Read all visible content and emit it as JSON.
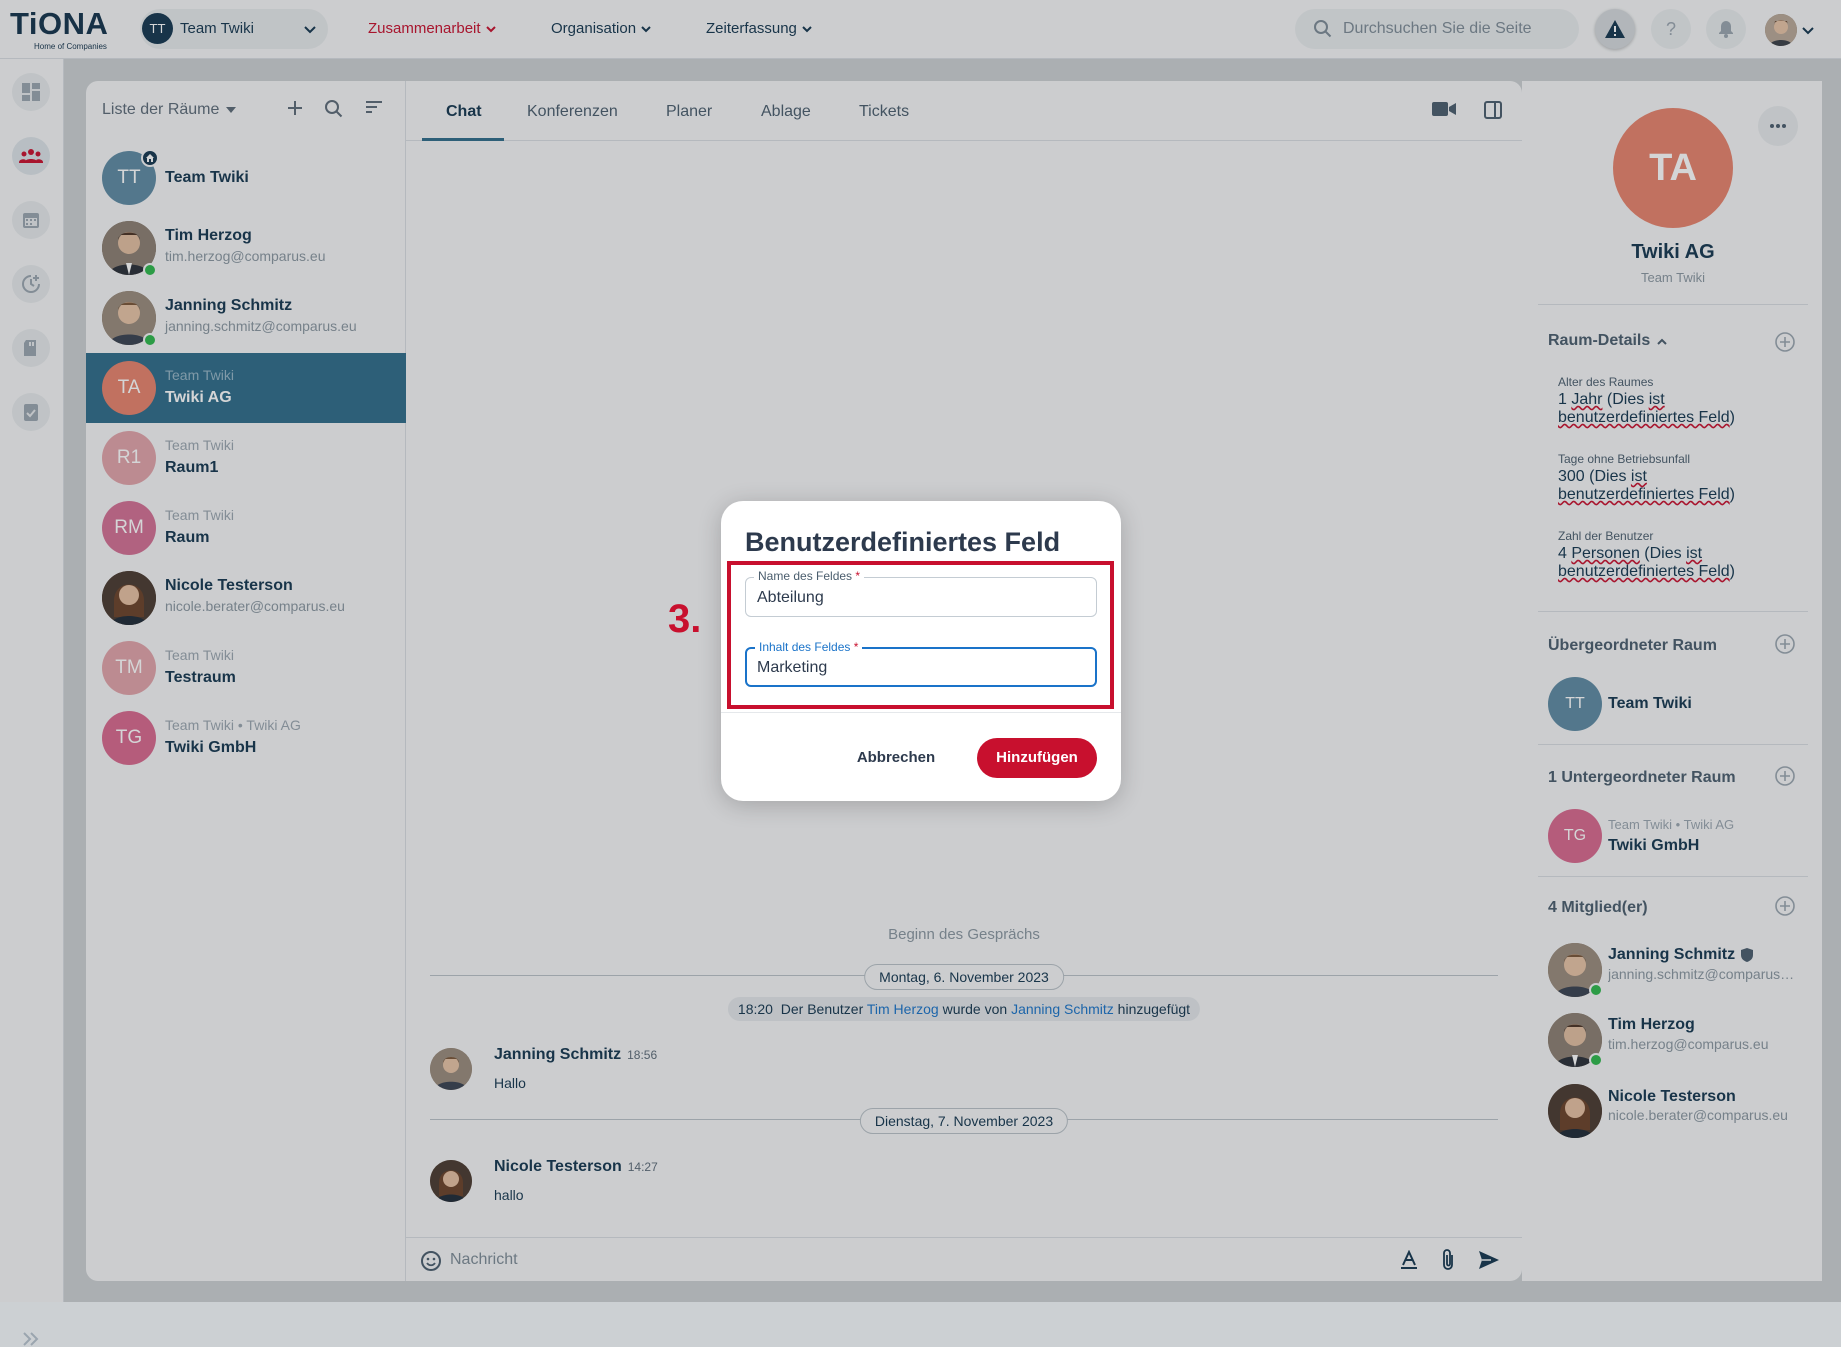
{
  "app": {
    "logo": "TiONA",
    "logo_sub": "Home of Companies"
  },
  "topbar": {
    "team_avatar": "TT",
    "team_name": "Team Twiki",
    "nav": [
      {
        "label": "Zusammenarbeit",
        "active": true
      },
      {
        "label": "Organisation",
        "active": false
      },
      {
        "label": "Zeiterfassung",
        "active": false
      }
    ],
    "search_placeholder": "Durchsuchen Sie die Seite",
    "icons": [
      "warning-icon",
      "help-icon",
      "bell-icon"
    ]
  },
  "rail": {
    "icons": [
      "dashboard-icon",
      "collaboration-icon",
      "calendar-icon",
      "time-icon",
      "folder-icon",
      "document-check-icon"
    ]
  },
  "rooms": {
    "header": "Liste der Räume",
    "items": [
      {
        "avatar": "TT",
        "top": "",
        "name": "Team Twiki",
        "sub": "",
        "color": "#5e8aa3"
      },
      {
        "avatar": "",
        "top": "",
        "name": "Tim Herzog",
        "sub": "tim.herzog@comparus.eu",
        "color": "#6b5a4d"
      },
      {
        "avatar": "",
        "top": "",
        "name": "Janning Schmitz",
        "sub": "janning.schmitz@comparus.eu",
        "color": "#7a6654"
      },
      {
        "avatar": "TA",
        "top": "Team Twiki",
        "name": "Twiki AG",
        "sub": "",
        "color": "#e8836c"
      },
      {
        "avatar": "R1",
        "top": "Team Twiki",
        "name": "Raum1",
        "sub": "",
        "color": "#e2a3a9"
      },
      {
        "avatar": "RM",
        "top": "Team Twiki",
        "name": "Raum",
        "sub": "",
        "color": "#d47094"
      },
      {
        "avatar": "",
        "top": "",
        "name": "Nicole Testerson",
        "sub": "nicole.berater@comparus.eu",
        "color": "#5c4336"
      },
      {
        "avatar": "TM",
        "top": "Team Twiki",
        "name": "Testraum",
        "sub": "",
        "color": "#e2a3a9"
      },
      {
        "avatar": "TG",
        "top": "Team Twiki • Twiki AG",
        "name": "Twiki GmbH",
        "sub": "",
        "color": "#d9688e"
      }
    ]
  },
  "chat": {
    "tabs": [
      "Chat",
      "Konferenzen",
      "Planer",
      "Ablage",
      "Tickets"
    ],
    "conversation_start": "Beginn des Gesprächs",
    "date1": "Montag, 6. November 2023",
    "system": {
      "time": "18:20",
      "pre": "Der Benutzer",
      "user": "Tim Herzog",
      "mid": "wurde von",
      "by": "Janning Schmitz",
      "post": "hinzugefügt"
    },
    "messages": [
      {
        "author": "Janning Schmitz",
        "time": "18:56",
        "text": "Hallo"
      },
      {
        "author": "Nicole Testerson",
        "time": "14:27",
        "text": "hallo"
      }
    ],
    "date2": "Dienstag, 7. November 2023",
    "composer_placeholder": "Nachricht"
  },
  "details": {
    "avatar": "TA",
    "title": "Twiki AG",
    "subtitle": "Team Twiki",
    "section_details": "Raum-Details",
    "fields": [
      {
        "label": "Alter des Raumes",
        "value_pre": "1 ",
        "value_u1": "Jahr",
        "value_mid": " (Dies ",
        "value_u2": "ist",
        "value_br": "benutzerdefiniertes Feld",
        "value_end": ")"
      },
      {
        "label": "Tage ohne Betriebsunfall",
        "value_pre": "300 ",
        "value_u1": "",
        "value_mid": "(Dies ",
        "value_u2": "ist",
        "value_br": "benutzerdefiniertes Feld",
        "value_end": ")"
      },
      {
        "label": "Zahl der Benutzer",
        "value_pre": "4 ",
        "value_u1": "Personen",
        "value_mid": " (Dies ",
        "value_u2": "ist",
        "value_br": "benutzerdefiniertes Feld",
        "value_end": ")"
      }
    ],
    "section_parent": "Übergeordneter Raum",
    "parent": {
      "avatar": "TT",
      "name": "Team Twiki"
    },
    "section_children": "1 Untergeordneter Raum",
    "child": {
      "avatar": "TG",
      "top": "Team Twiki • Twiki AG",
      "name": "Twiki GmbH"
    },
    "section_members": "4 Mitglied(er)",
    "members": [
      {
        "name": "Janning Schmitz",
        "email": "janning.schmitz@comparus.eu"
      },
      {
        "name": "Tim Herzog",
        "email": "tim.herzog@comparus.eu"
      },
      {
        "name": "Nicole Testerson",
        "email": "nicole.berater@comparus.eu"
      }
    ]
  },
  "dialog": {
    "title": "Benutzerdefiniertes Feld",
    "field1_label": "Name des Feldes",
    "field1_value": "Abteilung",
    "field2_label": "Inhalt des Feldes",
    "field2_value": "Marketing",
    "required": "*",
    "cancel": "Abbrechen",
    "submit": "Hinzufügen"
  },
  "annotation": {
    "step": "3."
  }
}
